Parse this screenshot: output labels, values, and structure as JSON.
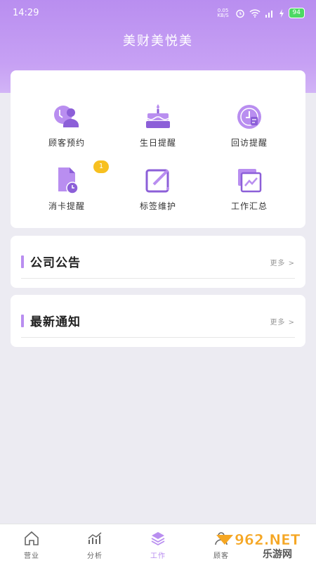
{
  "status": {
    "time": "14:29",
    "net_speed": "0.05 KB/S",
    "battery": "94"
  },
  "header": {
    "title": "美财美悦美"
  },
  "grid": {
    "items": [
      {
        "label": "顾客预约",
        "icon": "customer-appointment-icon"
      },
      {
        "label": "生日提醒",
        "icon": "birthday-cake-icon"
      },
      {
        "label": "回访提醒",
        "icon": "follow-up-clock-icon"
      },
      {
        "label": "消卡提醒",
        "icon": "card-consumption-icon",
        "badge": "1"
      },
      {
        "label": "标签维护",
        "icon": "tag-edit-icon"
      },
      {
        "label": "工作汇总",
        "icon": "work-summary-icon"
      }
    ]
  },
  "sections": {
    "announcement": {
      "title": "公司公告",
      "more": "更多 >"
    },
    "notice": {
      "title": "最新通知",
      "more": "更多 >"
    }
  },
  "tabs": [
    {
      "label": "营业",
      "icon": "home-icon",
      "active": false
    },
    {
      "label": "分析",
      "icon": "analytics-icon",
      "active": false
    },
    {
      "label": "工作",
      "icon": "layers-icon",
      "active": true
    },
    {
      "label": "顾客",
      "icon": "customer-icon",
      "active": false
    }
  ],
  "watermark": {
    "text": "962.NET",
    "subtext": "乐游网"
  },
  "colors": {
    "accent": "#b98ef0",
    "icon_dark": "#8c5fd8",
    "badge": "#f7c020"
  }
}
